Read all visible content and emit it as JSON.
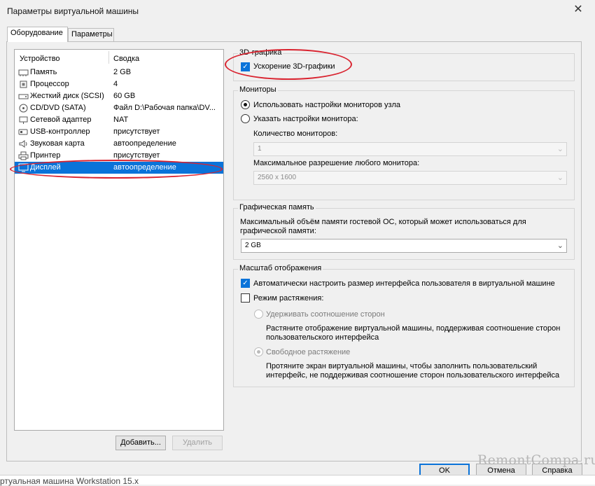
{
  "window": {
    "title": "Параметры виртуальной машины",
    "close": "✕"
  },
  "tabs": [
    {
      "label": "Оборудование"
    },
    {
      "label": "Параметры"
    }
  ],
  "device_list": {
    "col_device": "Устройство",
    "col_summary": "Сводка",
    "items": [
      {
        "name": "Память",
        "value": "2 GB",
        "icon": "memory-icon"
      },
      {
        "name": "Процессор",
        "value": "4",
        "icon": "cpu-icon"
      },
      {
        "name": "Жесткий диск (SCSI)",
        "value": "60 GB",
        "icon": "hard-disk-icon"
      },
      {
        "name": "CD/DVD (SATA)",
        "value": "Файл D:\\Рабочая папка\\DV...",
        "icon": "cd-dvd-icon"
      },
      {
        "name": "Сетевой адаптер",
        "value": "NAT",
        "icon": "network-adapter-icon"
      },
      {
        "name": "USB-контроллер",
        "value": "присутствует",
        "icon": "usb-icon"
      },
      {
        "name": "Звуковая карта",
        "value": "автоопределение",
        "icon": "sound-card-icon"
      },
      {
        "name": "Принтер",
        "value": "присутствует",
        "icon": "printer-icon"
      },
      {
        "name": "Дисплей",
        "value": "автоопределение",
        "icon": "display-icon",
        "selected": true
      }
    ],
    "add_button": "Добавить...",
    "remove_button": "Удалить"
  },
  "graphics3d": {
    "title": "3D-графика",
    "accel_label": "Ускорение 3D-графики",
    "accel_checked": true
  },
  "monitors": {
    "title": "Мониторы",
    "use_host_label": "Использовать настройки мониторов узла",
    "specify_label": "Указать настройки монитора:",
    "count_label": "Количество мониторов:",
    "count_value": "1",
    "maxres_label": "Максимальное разрешение любого монитора:",
    "maxres_value": "2560 x 1600"
  },
  "gfx_memory": {
    "title": "Графическая память",
    "desc": "Максимальный объём памяти гостевой ОС, который может использоваться для графической памяти:",
    "value": "2 GB"
  },
  "scaling": {
    "title": "Масштаб отображения",
    "auto_label": "Автоматически настроить размер интерфейса пользователя в виртуальной машине",
    "auto_checked": true,
    "stretch_label": "Режим растяжения:",
    "stretch_checked": false,
    "keep_aspect_label": "Удерживать соотношение сторон",
    "keep_aspect_desc": "Растяните отображение виртуальной машины, поддерживая соотношение сторон пользовательского интерфейса",
    "free_label": "Свободное растяжение",
    "free_desc": "Протяните экран виртуальной машины, чтобы заполнить пользовательский интерфейс, не поддерживая соотношение сторон пользовательского интерфейса"
  },
  "footer": {
    "ok": "OK",
    "cancel": "Отмена",
    "help": "Справка"
  },
  "watermark": "RemontCompa.ru",
  "background_text": "ртуальная машина Workstation 15.x",
  "colors": {
    "selection": "#0a73d9",
    "annotation": "#d9232f"
  }
}
